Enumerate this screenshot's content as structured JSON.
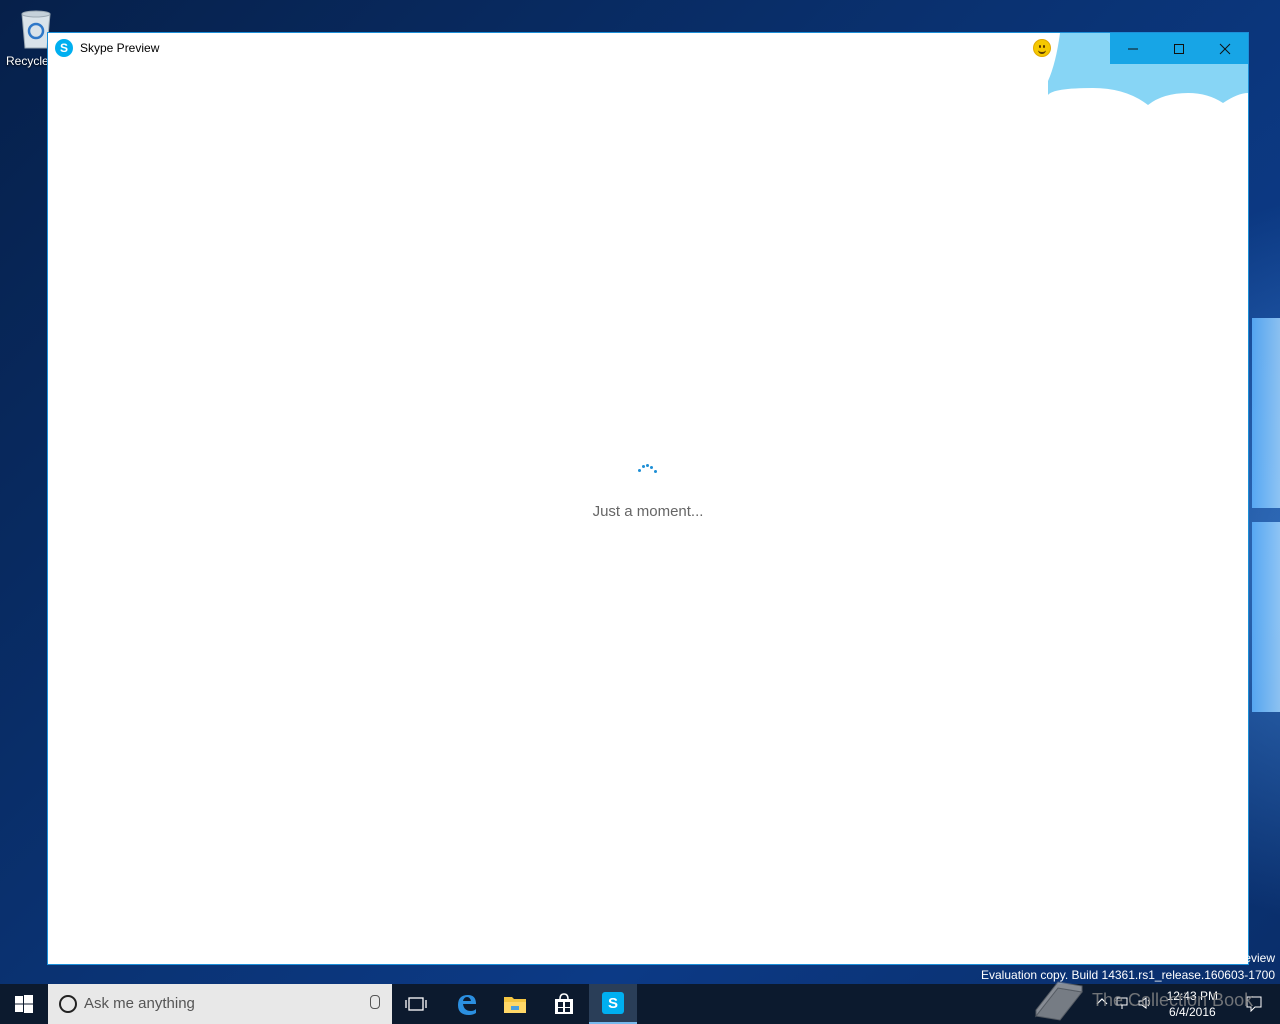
{
  "desktop": {
    "recycle_label": "Recycle Bin"
  },
  "window": {
    "title": "Skype Preview",
    "app_icon_letter": "S",
    "controls": {
      "minimize": "—",
      "maximize": "☐",
      "close": "✕"
    },
    "loading_text": "Just a moment...",
    "accent_color": "#00aff0"
  },
  "watermark": {
    "preview_fragment": "eview",
    "build_text": "Evaluation copy. Build 14361.rs1_release.160603-1700",
    "site_text": "The Collection Book"
  },
  "taskbar": {
    "search_placeholder": "Ask me anything",
    "clock_time": "12:43 PM",
    "clock_date": "6/4/2016",
    "pinned": [
      "task-view-icon",
      "edge-icon",
      "file-explorer-icon",
      "store-icon",
      "skype-icon"
    ]
  }
}
